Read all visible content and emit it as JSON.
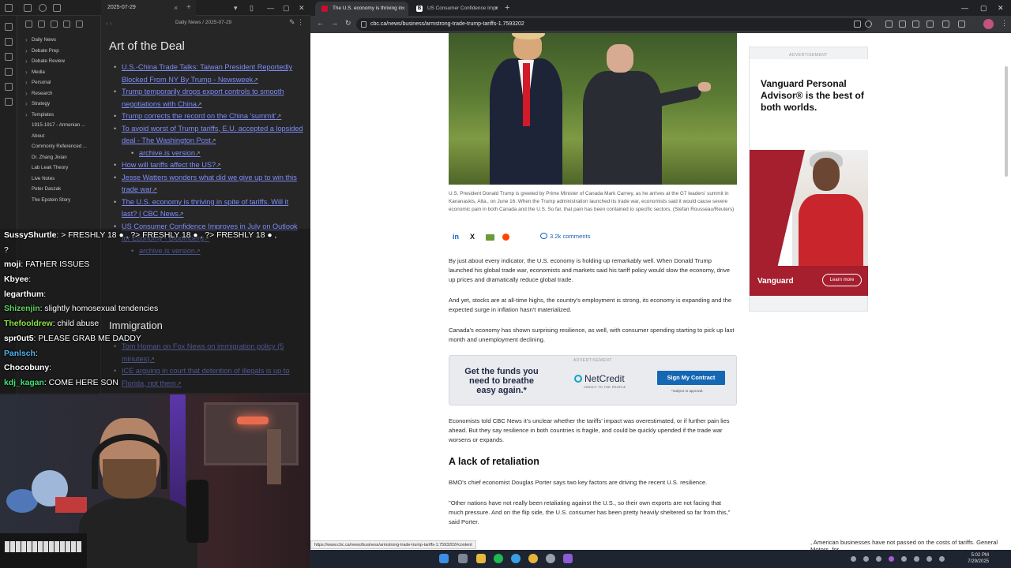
{
  "obsidian": {
    "tab_title": "2025-07-29",
    "breadcrumb": "Daily News / 2025-07-29",
    "tree": [
      {
        "label": "Daily News",
        "type": "folder"
      },
      {
        "label": "Debate Prep",
        "type": "folder"
      },
      {
        "label": "Debate Review",
        "type": "folder"
      },
      {
        "label": "Media",
        "type": "folder"
      },
      {
        "label": "Personal",
        "type": "folder"
      },
      {
        "label": "Research",
        "type": "folder"
      },
      {
        "label": "Strategy",
        "type": "folder"
      },
      {
        "label": "Templates",
        "type": "folder"
      },
      {
        "label": "1915-1917 - Armenian ...",
        "type": "file"
      },
      {
        "label": "About",
        "type": "file"
      },
      {
        "label": "Commonly Referenced ...",
        "type": "file"
      },
      {
        "label": "Dr. Zhang Jixian",
        "type": "file"
      },
      {
        "label": "Lab Leak Theory",
        "type": "file"
      },
      {
        "label": "Live Notes",
        "type": "file"
      },
      {
        "label": "Peter Daszak",
        "type": "file"
      },
      {
        "label": "The Epstein Story",
        "type": "file"
      }
    ],
    "heading": "Art of the Deal",
    "links": [
      {
        "text": "U.S.-China Trade Talks: Taiwan President Reportedly Blocked From NY By Trump - Newsweek",
        "sub": false
      },
      {
        "text": "Trump temporarily drops export controls to smooth negotiations with China",
        "sub": false
      },
      {
        "text": "Trump corrects the record on the China 'summit'",
        "sub": false
      },
      {
        "text": "To avoid worst of Trump tariffs, E.U. accepted a lopsided deal - The Washington Post",
        "sub": false
      },
      {
        "text": "archive.is version",
        "sub": true
      },
      {
        "text": "How will tariffs affect the US?",
        "sub": false
      },
      {
        "text": "Jesse Watters wonders what did we give up to win this trade war",
        "sub": false
      },
      {
        "text": "The U.S. economy is thriving in spite of tariffs. Will it last? | CBC News",
        "sub": false
      },
      {
        "text": "US Consumer Confidence Improves in July on Outlook for Economy - Bloomberg",
        "sub": false
      },
      {
        "text": "archive.is version",
        "sub": true
      }
    ],
    "heading2": "Immigration",
    "links2": [
      "Tom Homan on Fox News on immigration policy (5 minutes)",
      "ICE arguing in court that detention of illegals is up to Florida, not them"
    ]
  },
  "chat": [
    {
      "user": "SussyShurtle",
      "color": "#ffffff",
      "text": ": > FRESHLY 18 ● , ?> FRESHLY 18 ● , ?> FRESHLY 18 ● ,"
    },
    {
      "user": "",
      "color": "#ffffff",
      "text": "?"
    },
    {
      "user": "moji",
      "color": "#ffffff",
      "text": ": FATHER ISSUES"
    },
    {
      "user": "Kbyee",
      "color": "#ffffff",
      "text": ":"
    },
    {
      "user": "legarthum",
      "color": "#ffffff",
      "text": ":"
    },
    {
      "user": "Shizenjin",
      "color": "#5fd35f",
      "text": ": slightly homosexual tendencies"
    },
    {
      "user": "Thefooldrew",
      "color": "#8ee04a",
      "text": ": child abuse"
    },
    {
      "user": "spr0ut5",
      "color": "#ffffff",
      "text": ": PLEASE GRAB ME DADDY"
    },
    {
      "user": "Panlsch",
      "color": "#4fb3f0",
      "text": ":"
    },
    {
      "user": "Chocobuny",
      "color": "#ffffff",
      "text": ":"
    },
    {
      "user": "kdj_kagan",
      "color": "#3fe07a",
      "text": ": COME HERE SON"
    }
  ],
  "browser": {
    "tabs": [
      {
        "title": "The U.S. economy is thriving in",
        "favicon_color": "#c8102e",
        "active": true
      },
      {
        "title": "US Consumer Confidence Impr",
        "favicon_color": "#ffffff",
        "active": false
      }
    ],
    "url": "cbc.ca/news/business/armstrong-trade-trump-tariffs-1.7593202",
    "status_url": "https://www.cbc.ca/news/business/armstrong-trade-trump-tariffs-1.7593202#content"
  },
  "article": {
    "caption": "U.S. President Donald Trump is greeted by Prime Minister of Canada Mark Carney, as he arrives at the G7 leaders' summit in Kananaskis, Alta., on June 16. When the Trump administration launched its trade war, economists said it would cause severe economic pain in both Canada and the U.S. So far, that pain has been contained to specific sectors. (Stefan Rousseau/Reuters)",
    "comments": "3.2k comments",
    "p1": "By just about every indicator, the U.S. economy is holding up remarkably well. When Donald Trump launched his global trade war, economists and markets said his tariff policy would slow the economy, drive up prices and dramatically reduce global trade.",
    "p2": "And yet, stocks are at all-time highs, the country's employment is strong, its economy is expanding and the expected surge in inflation hasn't materialized.",
    "p3": "Canada's economy has shown surprising resilience, as well, with consumer spending starting to pick up last month and unemployment declining.",
    "p4": "Economists told CBC News it's unclear whether the tariffs' impact was overestimated, or if further pain lies ahead. But they say resilience in both countries is fragile, and could be quickly upended if the trade war worsens or expands.",
    "subhead": "A lack of retaliation",
    "p5": "BMO's chief economist Douglas Porter says two key factors are driving the recent U.S. resilience.",
    "p6": "\"Other nations have not really been retaliating against the U.S., so their own exports are not facing that much pressure. And on the flip side, the U.S. consumer has been pretty heavily sheltered so far from this,\" said Porter.",
    "last_line": ", American businesses have not passed on the costs of tariffs. General Motors, for"
  },
  "ad_inline": {
    "label": "ADVERTISEMENT",
    "headline": "Get the funds you need to breathe easy again.*",
    "brand": "NetCredit",
    "tagline": "CREDIT TO THE PEOPLE",
    "cta": "Sign My Contract",
    "sub": "*Subject to approval."
  },
  "ad_side": {
    "label": "ADVERTISEMENT",
    "title": "Vanguard Personal Advisor® is the best of both worlds.",
    "brand": "Vanguard",
    "cta": "Learn more"
  },
  "taskbar": {
    "time": "5:02 PM",
    "date": "7/29/2025"
  }
}
